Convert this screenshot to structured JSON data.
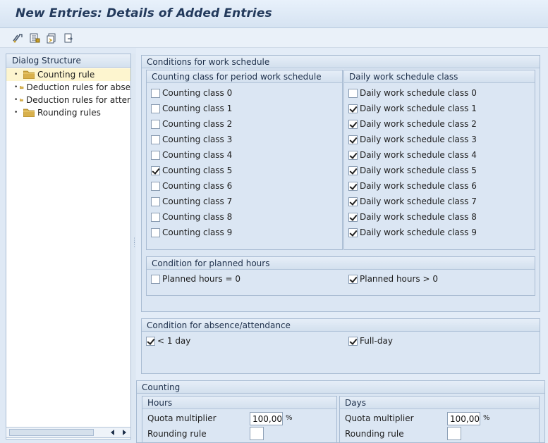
{
  "title": "New Entries: Details of Added Entries",
  "toolbar": {
    "icons": [
      "change-display-icon",
      "select-all-icon",
      "copy-icon",
      "export-icon"
    ]
  },
  "dialog_structure": {
    "header": "Dialog Structure",
    "items": [
      {
        "label": "Counting rule",
        "selected": true
      },
      {
        "label": "Deduction rules for abse",
        "selected": false
      },
      {
        "label": "Deduction rules for atter",
        "selected": false
      },
      {
        "label": "Rounding rules",
        "selected": false
      }
    ]
  },
  "work_schedule": {
    "header": "Conditions for work schedule",
    "period": {
      "header": "Counting class for period work schedule",
      "items": [
        {
          "label": "Counting class 0",
          "checked": false
        },
        {
          "label": "Counting class 1",
          "checked": false
        },
        {
          "label": "Counting class 2",
          "checked": false
        },
        {
          "label": "Counting class 3",
          "checked": false
        },
        {
          "label": "Counting class 4",
          "checked": false
        },
        {
          "label": "Counting class 5",
          "checked": true
        },
        {
          "label": "Counting class 6",
          "checked": false
        },
        {
          "label": "Counting class 7",
          "checked": false
        },
        {
          "label": "Counting class 8",
          "checked": false
        },
        {
          "label": "Counting class 9",
          "checked": false
        }
      ]
    },
    "daily": {
      "header": "Daily work schedule class",
      "items": [
        {
          "label": "Daily work schedule class 0",
          "checked": false
        },
        {
          "label": "Daily work schedule class 1",
          "checked": true
        },
        {
          "label": "Daily work schedule class 2",
          "checked": true
        },
        {
          "label": "Daily work schedule class 3",
          "checked": true
        },
        {
          "label": "Daily work schedule class 4",
          "checked": true
        },
        {
          "label": "Daily work schedule class 5",
          "checked": true
        },
        {
          "label": "Daily work schedule class 6",
          "checked": true
        },
        {
          "label": "Daily work schedule class 7",
          "checked": true
        },
        {
          "label": "Daily work schedule class 8",
          "checked": true
        },
        {
          "label": "Daily work schedule class 9",
          "checked": true
        }
      ]
    },
    "planned_hours": {
      "header": "Condition for planned hours",
      "eq0": {
        "label": "Planned hours = 0",
        "checked": false
      },
      "gt0": {
        "label": "Planned hours > 0",
        "checked": true
      }
    }
  },
  "absence": {
    "header": "Condition for absence/attendance",
    "lt1": {
      "label": "< 1 day",
      "checked": true
    },
    "full": {
      "label": "Full-day",
      "checked": true
    }
  },
  "counting": {
    "header": "Counting",
    "hours": {
      "header": "Hours",
      "quota_label": "Quota multiplier",
      "quota_value": "100,00",
      "unit": "%",
      "rounding_label": "Rounding rule",
      "rounding_value": ""
    },
    "days": {
      "header": "Days",
      "quota_label": "Quota multiplier",
      "quota_value": "100,00",
      "unit": "%",
      "rounding_label": "Rounding rule",
      "rounding_value": ""
    }
  },
  "colors": {
    "title_text": "#233a5c",
    "group_bg": "#dbe6f3",
    "selected_tree_bg": "#fdf5cf"
  }
}
